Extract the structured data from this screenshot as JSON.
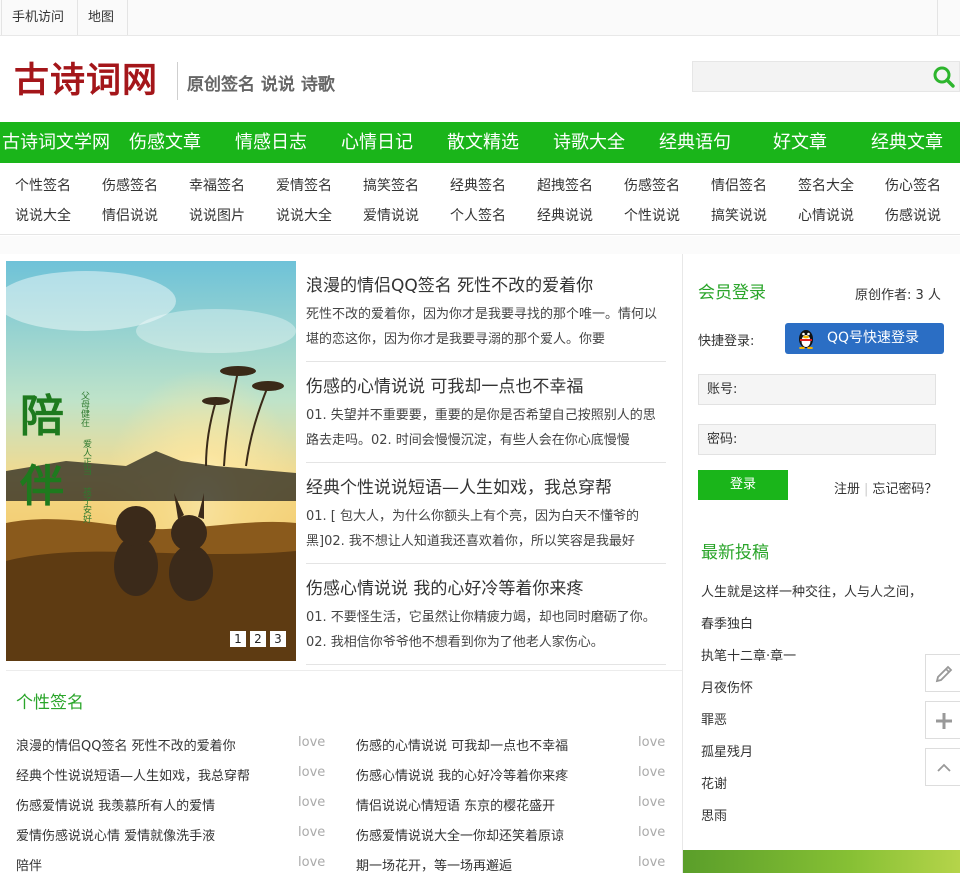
{
  "topbar": {
    "mobile": "手机访问",
    "map": "地图"
  },
  "header": {
    "logo": "古诗词网",
    "slogan": "原创签名 说说 诗歌",
    "search_placeholder": ""
  },
  "nav": [
    "古诗词文学网",
    "伤感文章",
    "情感日志",
    "心情日记",
    "散文精选",
    "诗歌大全",
    "经典语句",
    "好文章",
    "经典文章"
  ],
  "sublinks_row1": [
    "个性签名",
    "伤感签名",
    "幸福签名",
    "爱情签名",
    "搞笑签名",
    "经典签名",
    "超拽签名",
    "伤感签名",
    "情侣签名",
    "签名大全",
    "伤心签名"
  ],
  "sublinks_row2": [
    "说说大全",
    "情侣说说",
    "说说图片",
    "说说大全",
    "爱情说说",
    "个人签名",
    "经典说说",
    "个性说说",
    "搞笑说说",
    "心情说说",
    "伤感说说"
  ],
  "slide": {
    "poster_big": [
      "陪",
      "伴"
    ],
    "poster_small1": "父母健在",
    "poster_small2": "爱人正当",
    "poster_small3": "孩子安好",
    "pages": [
      "1",
      "2",
      "3"
    ]
  },
  "articles": [
    {
      "title": "浪漫的情侣QQ签名 死性不改的爱着你",
      "desc": "死性不改的爱着你，因为你才是我要寻找的那个唯一。情何以堪的恋这你，因为你才是我要寻溺的那个爱人。你要"
    },
    {
      "title": "伤感的心情说说 可我却一点也不幸福",
      "desc": "01. 失望并不重要要，重要的是你是否希望自己按照别人的思路去走吗。02. 时间会慢慢沉淀，有些人会在你心底慢慢"
    },
    {
      "title": "经典个性说说短语—人生如戏，我总穿帮",
      "desc": "01. [ 包大人，为什么你额头上有个亮，因为白天不懂爷的黑]02. 我不想让人知道我还喜欢着你，所以笑容是我最好"
    },
    {
      "title": "伤感心情说说 我的心好冷等着你来疼",
      "desc": "01. 不要怪生活，它虽然让你精疲力竭，却也同时磨砺了你。02. 我相信你爷爷他不想看到你为了他老人家伤心。"
    }
  ],
  "member": {
    "title": "会员登录",
    "authors": "原创作者: 3 人",
    "quick_login": "快捷登录:",
    "qq_button": "QQ号快速登录",
    "account_label": "账号:",
    "password_label": "密码:",
    "login_button": "登录",
    "register": "注册",
    "forgot": "忘记密码？"
  },
  "latest": {
    "title": "最新投稿",
    "items": [
      "人生就是这样一种交往，人与人之间，",
      "春季独白",
      "执笔十二章·章一",
      "月夜伤怀",
      "罪恶",
      "孤星残月",
      "花谢",
      "思雨"
    ]
  },
  "signatures": {
    "title": "个性签名",
    "tag": "love",
    "left": [
      "浪漫的情侣QQ签名 死性不改的爱着你",
      "经典个性说说短语—人生如戏，我总穿帮",
      "伤感爱情说说 我羡慕所有人的爱情",
      "爱情伤感说说心情 爱情就像洗手液",
      "陪伴"
    ],
    "right": [
      "伤感的心情说说 可我却一点也不幸福",
      "伤感心情说说 我的心好冷等着你来疼",
      "情侣说说心情短语 东京的樱花盛开",
      "伤感爱情说说大全一你却还笑着原谅",
      "期一场花开，等一场再邂逅"
    ]
  },
  "colors": {
    "brand_green": "#1ab51a",
    "logo_red": "#a4161a",
    "qq_blue": "#2b6ec4",
    "title_green": "#2aa52a"
  },
  "icons": {
    "search": "search-icon",
    "qq": "qq-penguin-icon",
    "edit": "pencil-icon",
    "add": "plus-icon",
    "top": "chevron-up-icon"
  }
}
